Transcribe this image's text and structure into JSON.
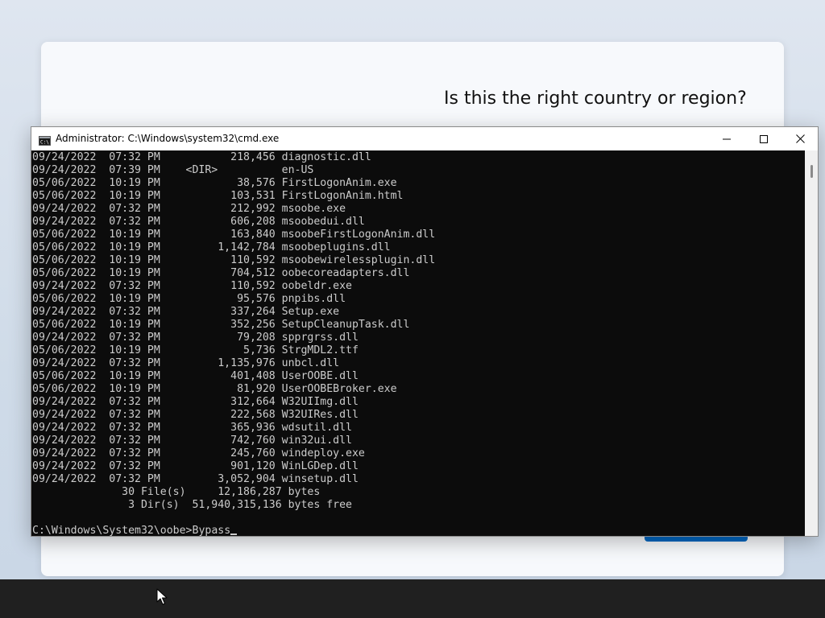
{
  "oobe": {
    "title": "Is this the right country or region?",
    "accent_color": "#0067c0"
  },
  "cmd": {
    "title": "Administrator: C:\\Windows\\system32\\cmd.exe",
    "icon": "cmd-icon",
    "buttons": {
      "minimize": "minimize-icon",
      "maximize": "maximize-icon",
      "close": "close-icon"
    },
    "lines": [
      "09/24/2022  07:32 PM           218,456 diagnostic.dll",
      "09/24/2022  07:39 PM    <DIR>          en-US",
      "05/06/2022  10:19 PM            38,576 FirstLogonAnim.exe",
      "05/06/2022  10:19 PM           103,531 FirstLogonAnim.html",
      "09/24/2022  07:32 PM           212,992 msoobe.exe",
      "09/24/2022  07:32 PM           606,208 msoobedui.dll",
      "05/06/2022  10:19 PM           163,840 msoobeFirstLogonAnim.dll",
      "05/06/2022  10:19 PM         1,142,784 msoobeplugins.dll",
      "05/06/2022  10:19 PM           110,592 msoobewirelessplugin.dll",
      "05/06/2022  10:19 PM           704,512 oobecoreadapters.dll",
      "09/24/2022  07:32 PM           110,592 oobeldr.exe",
      "05/06/2022  10:19 PM            95,576 pnpibs.dll",
      "09/24/2022  07:32 PM           337,264 Setup.exe",
      "05/06/2022  10:19 PM           352,256 SetupCleanupTask.dll",
      "09/24/2022  07:32 PM            79,208 spprgrss.dll",
      "05/06/2022  10:19 PM             5,736 StrgMDL2.ttf",
      "09/24/2022  07:32 PM         1,135,976 unbcl.dll",
      "05/06/2022  10:19 PM           401,408 UserOOBE.dll",
      "05/06/2022  10:19 PM            81,920 UserOOBEBroker.exe",
      "09/24/2022  07:32 PM           312,664 W32UIImg.dll",
      "09/24/2022  07:32 PM           222,568 W32UIRes.dll",
      "09/24/2022  07:32 PM           365,936 wdsutil.dll",
      "09/24/2022  07:32 PM           742,760 win32ui.dll",
      "09/24/2022  07:32 PM           245,760 windeploy.exe",
      "09/24/2022  07:32 PM           901,120 WinLGDep.dll",
      "09/24/2022  07:32 PM         3,052,904 winsetup.dll",
      "              30 File(s)     12,186,287 bytes",
      "               3 Dir(s)  51,940,315,136 bytes free"
    ],
    "prompt": "C:\\Windows\\System32\\oobe>",
    "input": "Bypass",
    "console_bg": "#0c0c0c",
    "console_fg": "#cccccc"
  },
  "taskbar": {
    "cursor": "mouse-pointer-icon"
  }
}
